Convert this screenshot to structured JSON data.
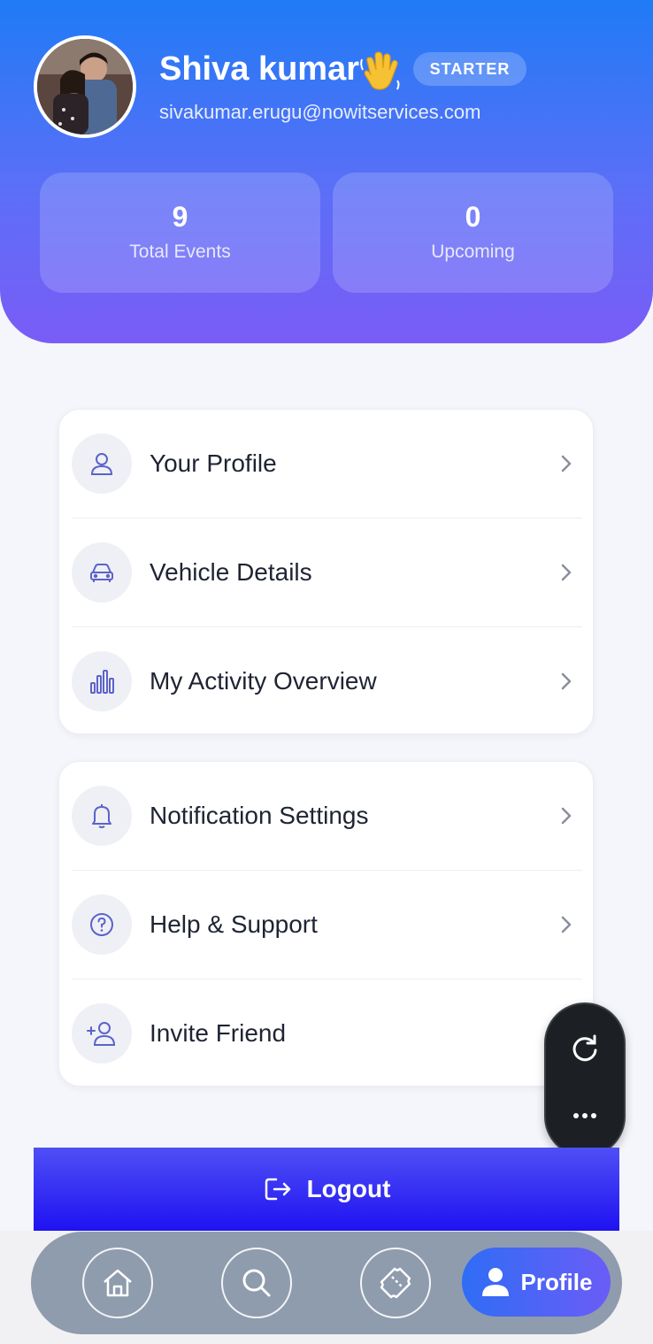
{
  "profile": {
    "name": "Shiva kumar",
    "plan_badge": "STARTER",
    "email": "sivakumar.erugu@nowitservices.com",
    "avatar_icon": "profile-photo"
  },
  "stats": [
    {
      "value": "9",
      "label": "Total Events"
    },
    {
      "value": "0",
      "label": "Upcoming"
    }
  ],
  "menu_group_1": [
    {
      "label": "Your Profile",
      "icon": "user-icon"
    },
    {
      "label": "Vehicle Details",
      "icon": "car-icon"
    },
    {
      "label": "My Activity Overview",
      "icon": "bar-chart-icon"
    }
  ],
  "menu_group_2": [
    {
      "label": "Notification Settings",
      "icon": "bell-icon"
    },
    {
      "label": "Help & Support",
      "icon": "help-icon"
    },
    {
      "label": "Invite Friend",
      "icon": "add-user-icon"
    }
  ],
  "logout_label": "Logout",
  "nav": {
    "items": [
      {
        "icon": "home-icon"
      },
      {
        "icon": "search-icon"
      },
      {
        "icon": "ticket-icon"
      }
    ],
    "active_label": "Profile"
  },
  "colors": {
    "header_top": "#1f7bf6",
    "header_bottom": "#7a5cf6",
    "icon_accent": "#5b63c9",
    "logout": "#1f12f2",
    "nav_bar": "#8f9cae"
  }
}
